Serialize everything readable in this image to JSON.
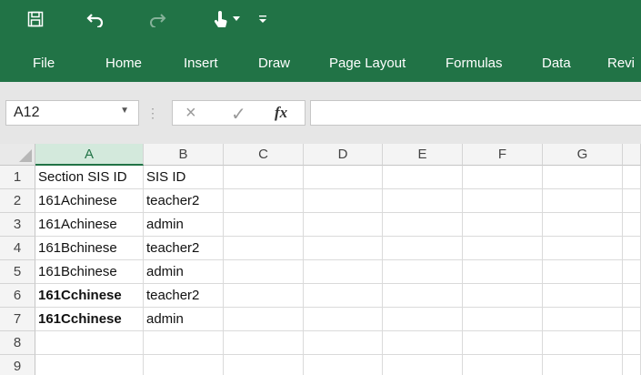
{
  "quick_access": {
    "save_icon": "save-icon",
    "undo_icon": "undo-icon",
    "redo_icon": "redo-icon",
    "touch_mode_icon": "touch-mode-icon",
    "customize_icon": "customize-icon"
  },
  "menu": {
    "tabs": [
      "File",
      "Home",
      "Insert",
      "Draw",
      "Page Layout",
      "Formulas",
      "Data",
      "Revi"
    ]
  },
  "formula_bar": {
    "name_box": "A12",
    "cancel_symbol": "×",
    "enter_symbol": "✓",
    "fx_label": "fx",
    "formula": ""
  },
  "sheet": {
    "columns": [
      "A",
      "B",
      "C",
      "D",
      "E",
      "F",
      "G"
    ],
    "selected_column": "A",
    "row_numbers": [
      "1",
      "2",
      "3",
      "4",
      "5",
      "6",
      "7",
      "8",
      "9"
    ],
    "rows": [
      [
        {
          "t": "Section SIS ID"
        },
        {
          "t": "SIS ID"
        }
      ],
      [
        {
          "t": "161Achinese"
        },
        {
          "t": "teacher2"
        }
      ],
      [
        {
          "t": "161Achinese"
        },
        {
          "t": "admin"
        }
      ],
      [
        {
          "t": "161Bchinese"
        },
        {
          "t": "teacher2"
        }
      ],
      [
        {
          "t": "161Bchinese"
        },
        {
          "t": "admin"
        }
      ],
      [
        {
          "t": "161Cchinese",
          "bold": true
        },
        {
          "t": "teacher2"
        }
      ],
      [
        {
          "t": "161Cchinese",
          "bold": true
        },
        {
          "t": "admin"
        }
      ],
      [
        {
          "t": ""
        },
        {
          "t": ""
        }
      ],
      [
        {
          "t": ""
        },
        {
          "t": ""
        }
      ]
    ]
  },
  "colors": {
    "ribbon": "#217346",
    "selected_header": "#d3e9dc"
  }
}
